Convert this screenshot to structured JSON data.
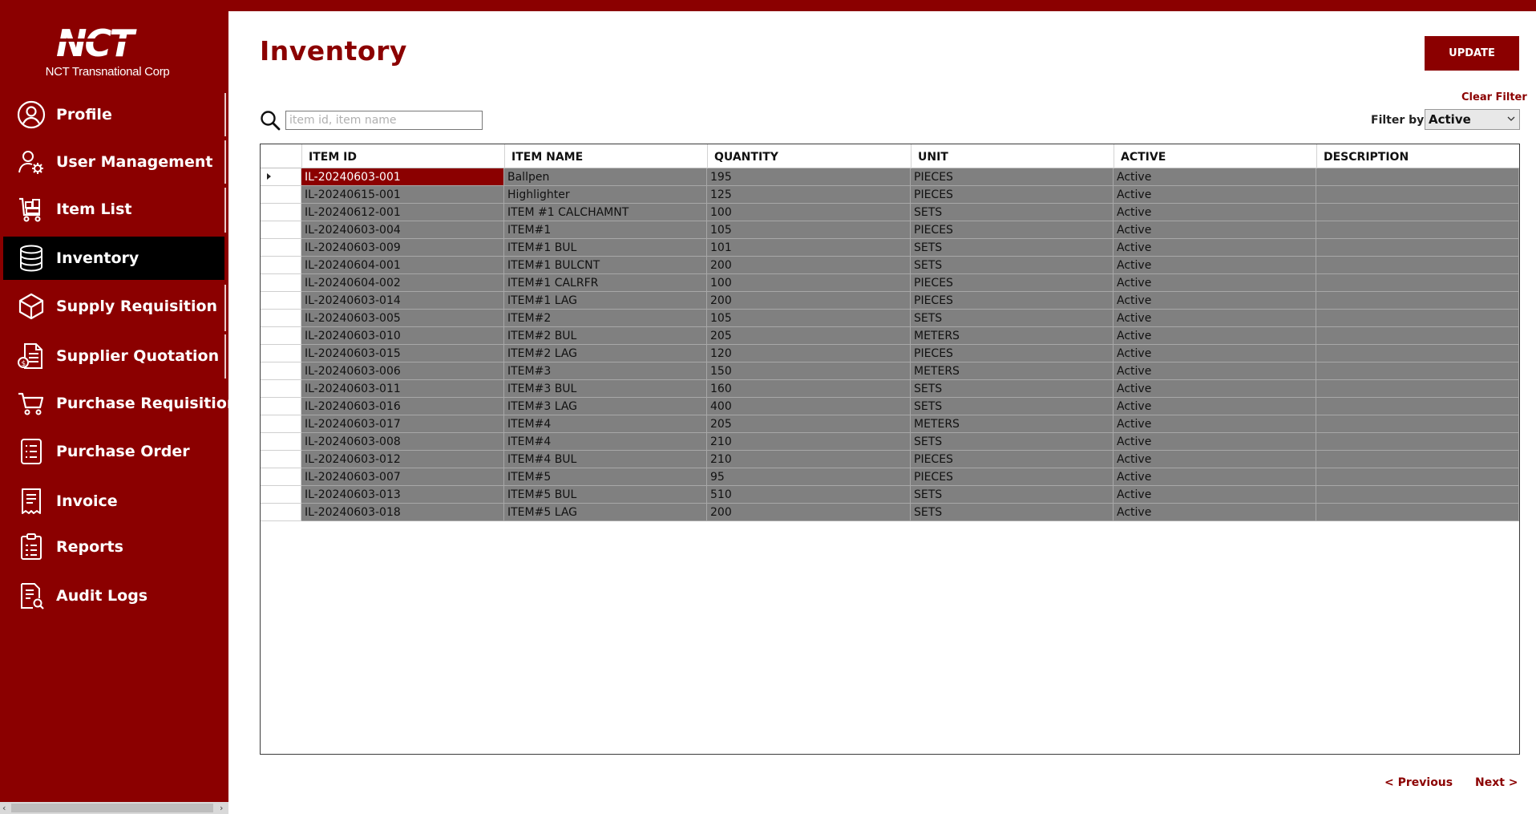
{
  "app": {
    "company_name": "NCT Transnational Corp",
    "logo_text": "NCT",
    "brand_color": "#8b0000"
  },
  "sidebar": {
    "items": [
      {
        "label": "Profile",
        "icon": "user-circle-icon",
        "active": false
      },
      {
        "label": "User Management",
        "icon": "user-gear-icon",
        "active": false
      },
      {
        "label": "Item List",
        "icon": "cart-boxes-icon",
        "active": false
      },
      {
        "label": "Inventory",
        "icon": "database-icon",
        "active": true
      },
      {
        "label": "Supply Requisition",
        "icon": "box-icon",
        "active": false
      },
      {
        "label": "Supplier Quotation",
        "icon": "quotation-document-icon",
        "active": false
      },
      {
        "label": "Purchase Requisition",
        "icon": "shopping-cart-icon",
        "active": false
      },
      {
        "label": "Purchase Order",
        "icon": "list-document-icon",
        "active": false
      },
      {
        "label": "Invoice",
        "icon": "receipt-icon",
        "active": false
      },
      {
        "label": "Reports",
        "icon": "clipboard-chart-icon",
        "active": false
      },
      {
        "label": "Audit Logs",
        "icon": "document-search-icon",
        "active": false
      }
    ]
  },
  "page": {
    "title": "Inventory",
    "update_label": "UPDATE",
    "clear_filter_label": "Clear Filter",
    "search_placeholder": "item id, item name",
    "search_value": "",
    "filter_label": "Filter by:",
    "filter_value": "Active"
  },
  "table": {
    "columns": [
      "ITEM ID",
      "ITEM NAME",
      "QUANTITY",
      "UNIT",
      "ACTIVE",
      "DESCRIPTION"
    ],
    "rows": [
      [
        "IL-20240603-001",
        "Ballpen",
        "195",
        "PIECES",
        "Active",
        ""
      ],
      [
        "IL-20240615-001",
        "Highlighter",
        "125",
        "PIECES",
        "Active",
        ""
      ],
      [
        "IL-20240612-001",
        "ITEM #1 CALCHAMNT",
        "100",
        "SETS",
        "Active",
        ""
      ],
      [
        "IL-20240603-004",
        "ITEM#1",
        "105",
        "PIECES",
        "Active",
        ""
      ],
      [
        "IL-20240603-009",
        "ITEM#1 BUL",
        "101",
        "SETS",
        "Active",
        ""
      ],
      [
        "IL-20240604-001",
        "ITEM#1 BULCNT",
        "200",
        "SETS",
        "Active",
        ""
      ],
      [
        "IL-20240604-002",
        "ITEM#1 CALRFR",
        "100",
        "PIECES",
        "Active",
        ""
      ],
      [
        "IL-20240603-014",
        "ITEM#1 LAG",
        "200",
        "PIECES",
        "Active",
        ""
      ],
      [
        "IL-20240603-005",
        "ITEM#2",
        "105",
        "SETS",
        "Active",
        ""
      ],
      [
        "IL-20240603-010",
        "ITEM#2 BUL",
        "205",
        "METERS",
        "Active",
        ""
      ],
      [
        "IL-20240603-015",
        "ITEM#2 LAG",
        "120",
        "PIECES",
        "Active",
        ""
      ],
      [
        "IL-20240603-006",
        "ITEM#3",
        "150",
        "METERS",
        "Active",
        ""
      ],
      [
        "IL-20240603-011",
        "ITEM#3 BUL",
        "160",
        "SETS",
        "Active",
        ""
      ],
      [
        "IL-20240603-016",
        "ITEM#3 LAG",
        "400",
        "SETS",
        "Active",
        ""
      ],
      [
        "IL-20240603-017",
        "ITEM#4",
        "205",
        "METERS",
        "Active",
        ""
      ],
      [
        "IL-20240603-008",
        "ITEM#4",
        "210",
        "SETS",
        "Active",
        ""
      ],
      [
        "IL-20240603-012",
        "ITEM#4 BUL",
        "210",
        "PIECES",
        "Active",
        ""
      ],
      [
        "IL-20240603-007",
        "ITEM#5",
        "95",
        "PIECES",
        "Active",
        ""
      ],
      [
        "IL-20240603-013",
        "ITEM#5 BUL",
        "510",
        "SETS",
        "Active",
        ""
      ],
      [
        "IL-20240603-018",
        "ITEM#5 LAG",
        "200",
        "SETS",
        "Active",
        ""
      ]
    ],
    "selected_row": 0
  },
  "pagination": {
    "prev_label": "< Previous",
    "next_label": "Next >"
  }
}
